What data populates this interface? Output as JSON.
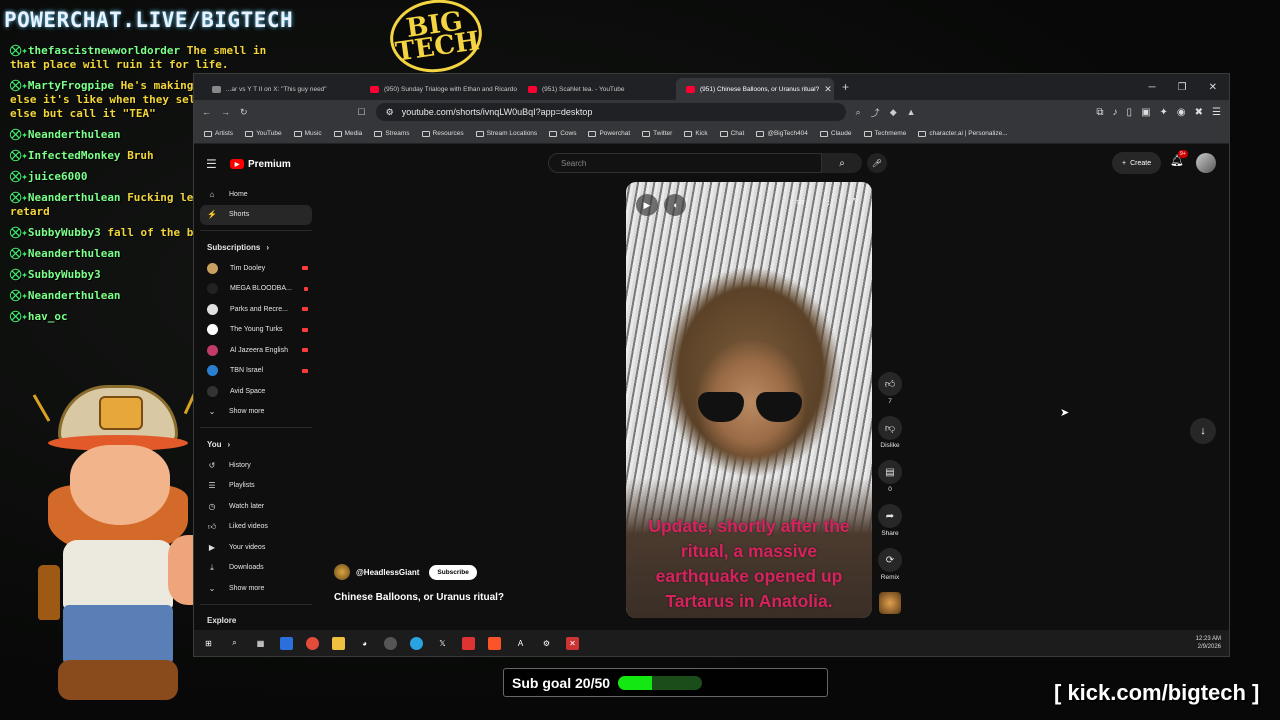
{
  "overlay": {
    "banner": "POWERCHAT.LIVE/BIGTECH",
    "logo_line1": "BIG",
    "logo_line2": "TECH",
    "sub_goal_label": "Sub goal 20/50",
    "sub_goal_progress": 0.4,
    "kick_url": "[ kick.com/bigtech ]",
    "chat": [
      {
        "user": "thefascistnewworldorder",
        "msg": "The smell in that place will ruin it for life."
      },
      {
        "user": "MartyFrogpipe",
        "msg": "He's making something else it's like when they sell something else but call it \"TEA\""
      },
      {
        "user": "Neanderthulean",
        "msg": ""
      },
      {
        "user": "InfectedMonkey",
        "msg": "Bruh"
      },
      {
        "user": "juice6000",
        "msg": ""
      },
      {
        "user": "Neanderthulean",
        "msg": "Fucking left Brained retard"
      },
      {
        "user": "SubbyWubby3",
        "msg": "fall of the balls"
      },
      {
        "user": "Neanderthulean",
        "msg": ""
      },
      {
        "user": "SubbyWubby3",
        "msg": ""
      },
      {
        "user": "Neanderthulean",
        "msg": ""
      },
      {
        "user": "hav_oc",
        "msg": ""
      }
    ]
  },
  "browser": {
    "tabs": [
      {
        "label": "...ar vs Y T II on X: \"This guy need\""
      },
      {
        "label": "(950) Sunday Trialoge with Ethan and Ricardo"
      },
      {
        "label": "(951) Scahlet tea. - YouTube"
      },
      {
        "label": "(951) Chinese Balloons, or Uranus ritual?"
      }
    ],
    "url": "youtube.com/shorts/ivnqLW0uBqI?app=desktop",
    "bookmarks": [
      "Artists",
      "YouTube",
      "Music",
      "Media",
      "Streams",
      "Resources",
      "Stream Locations",
      "Cows",
      "Powerchat",
      "Twitter",
      "Kick",
      "Chat",
      "@BigTech404",
      "Claude",
      "Techmeme",
      "character.ai | Personalize..."
    ]
  },
  "youtube": {
    "logo": "Premium",
    "search_placeholder": "Search",
    "create_label": "Create",
    "notifications": "9+",
    "nav": [
      {
        "label": "Home",
        "icon": "home-icon"
      },
      {
        "label": "Shorts",
        "icon": "shorts-icon"
      }
    ],
    "subscriptions_header": "Subscriptions",
    "subscriptions": [
      {
        "label": "Tim Dooley",
        "color": "#c8a060"
      },
      {
        "label": "MEGA BLOODBA...",
        "color": "#222222"
      },
      {
        "label": "Parks and Recre...",
        "color": "#e0e0e0"
      },
      {
        "label": "The Young Turks",
        "color": "#ffffff"
      },
      {
        "label": "Al Jazeera English",
        "color": "#c23b6b"
      },
      {
        "label": "TBN Israel",
        "color": "#2a7fd0"
      },
      {
        "label": "Avid Space",
        "color": "#333333"
      }
    ],
    "show_more": "Show more",
    "you_header": "You",
    "you_items": [
      {
        "label": "History"
      },
      {
        "label": "Playlists"
      },
      {
        "label": "Watch later"
      },
      {
        "label": "Liked videos"
      },
      {
        "label": "Your videos"
      },
      {
        "label": "Downloads"
      }
    ],
    "show_more_2": "Show more",
    "explore": "Explore",
    "short": {
      "overlay_text": "Update, shortly after the ritual, a massive earthquake opened up Tartarus in Anatolia.",
      "channel": "@HeadlessGiant",
      "subscribe": "Subscribe",
      "title": "Chinese Balloons, or Uranus ritual?"
    },
    "actions": {
      "likes": "7",
      "dislike": "Dislike",
      "comments": "0",
      "share": "Share",
      "remix": "Remix"
    }
  },
  "taskbar": {
    "time": "12:23 AM",
    "date": "2/9/2026"
  }
}
